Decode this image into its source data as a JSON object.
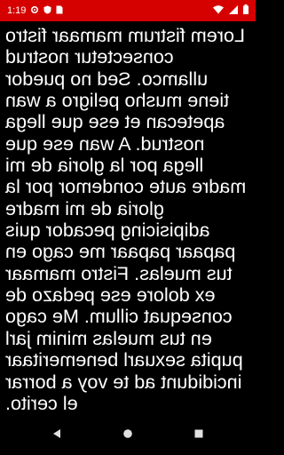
{
  "status_bar": {
    "time": "1:19",
    "notification_icons": [
      "gear-icon",
      "shield-icon",
      "sim-icon"
    ],
    "right_icons": [
      "wifi-icon",
      "cellular-icon",
      "battery-icon"
    ],
    "background_color": "#d50000"
  },
  "reader": {
    "mirrored": true,
    "text": "Lorem fistrum mamaar fistro consectetur nostrud ullamco. Sed no puedor tiene musho peligro a wan apetecan et ese que llega nostrud. A wan ese que llega por la gloria de mi madre aute condemor por la gloria de mi madre adipisicing pecador quis papaar papaar me cago en tus muelas. Fistro mamaar ex dolore ese pedazo de consequat cillum. Me cago en tus muelas minim jarl pupita sexuarl benemeritaar incididunt ad te voy a borrar el cerito.",
    "text_color": "#ffffff",
    "background_color": "#000000"
  },
  "nav_bar": {
    "buttons": [
      "back-icon",
      "home-icon",
      "recents-icon"
    ]
  }
}
